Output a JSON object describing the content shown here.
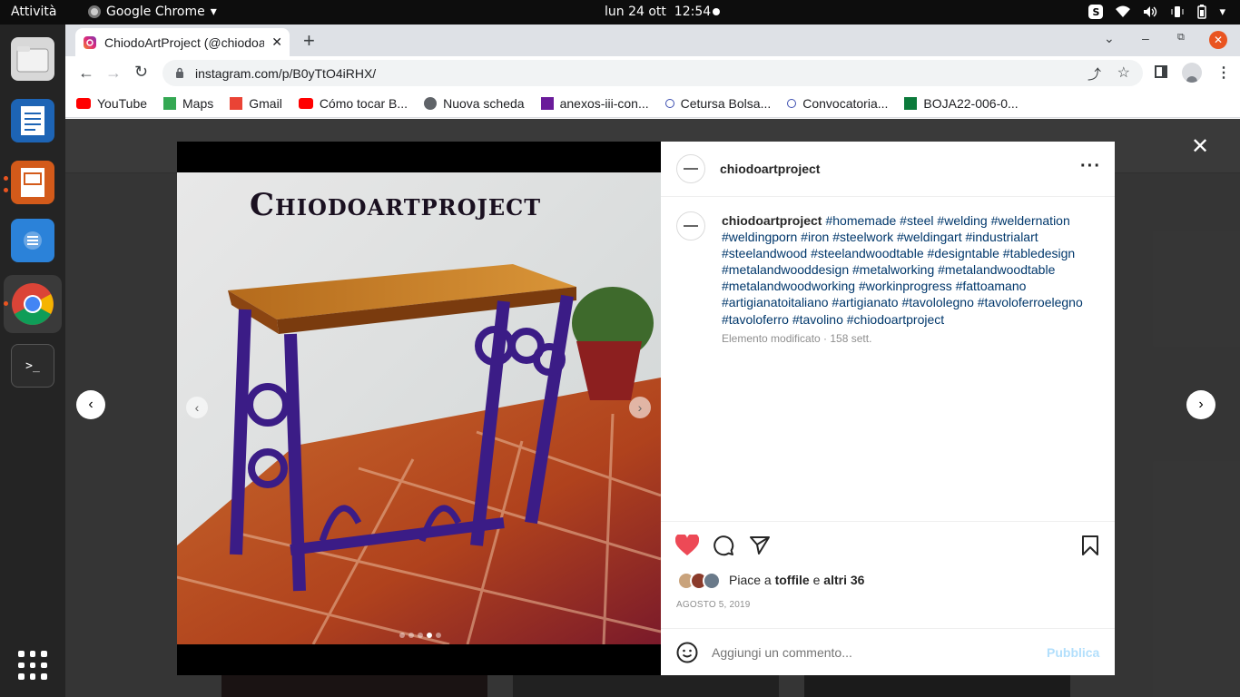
{
  "topbar": {
    "activities": "Attività",
    "app_name": "Google Chrome",
    "clock": "lun 24 ott  12:54"
  },
  "browser": {
    "tab_title": "ChiodoArtProject (@chiodoartproject)",
    "url": "instagram.com/p/B0yTtO4iRHX/",
    "bookmarks": [
      {
        "label": "YouTube",
        "icon": "youtube-icon",
        "color": "#ff0000"
      },
      {
        "label": "Maps",
        "icon": "maps-icon",
        "color": "#34a853"
      },
      {
        "label": "Gmail",
        "icon": "gmail-icon",
        "color": "#ea4335"
      },
      {
        "label": "Cómo tocar B...",
        "icon": "youtube-icon",
        "color": "#ff0000"
      },
      {
        "label": "Nuova scheda",
        "icon": "globe-icon",
        "color": "#5f6368"
      },
      {
        "label": "anexos-iii-con...",
        "icon": "doc-icon",
        "color": "#6a1b9a"
      },
      {
        "label": "Cetursa Bolsa...",
        "icon": "ring-icon",
        "color": "#3c4eb0"
      },
      {
        "label": "Convocatoria...",
        "icon": "ring-icon",
        "color": "#3c4eb0"
      },
      {
        "label": "BOJA22-006-0...",
        "icon": "junta-icon",
        "color": "#0b7a3b"
      }
    ]
  },
  "post": {
    "image_title": "Chiodoartproject",
    "username": "chiodoartproject",
    "caption": "#homemade #steel #welding #weldernation #weldingporn #iron #steelwork #weldingart #industrialart #steelandwood #steelandwoodtable #designtable #tabledesign #metalandwooddesign #metalworking #metalandwoodtable #metalandwoodworking #workinprogress #fattoamano #artigianatoitaliano #artigianato #tavololegno #tavoloferroelegno #tavoloferro #tavolino #chiodoartproject",
    "edited_meta": "Elemento modificato · 158 sett.",
    "likes_prefix": "Piace a ",
    "likes_user": "toffile",
    "likes_conj": " e ",
    "likes_others": "altri 36",
    "date": "AGOSTO 5, 2019",
    "comment_placeholder": "Aggiungi un commento...",
    "publish_label": "Pubblica",
    "carousel_count": 5,
    "carousel_active": 4
  },
  "colors": {
    "like": "#ed4956",
    "link_blue": "#b2dffc"
  }
}
